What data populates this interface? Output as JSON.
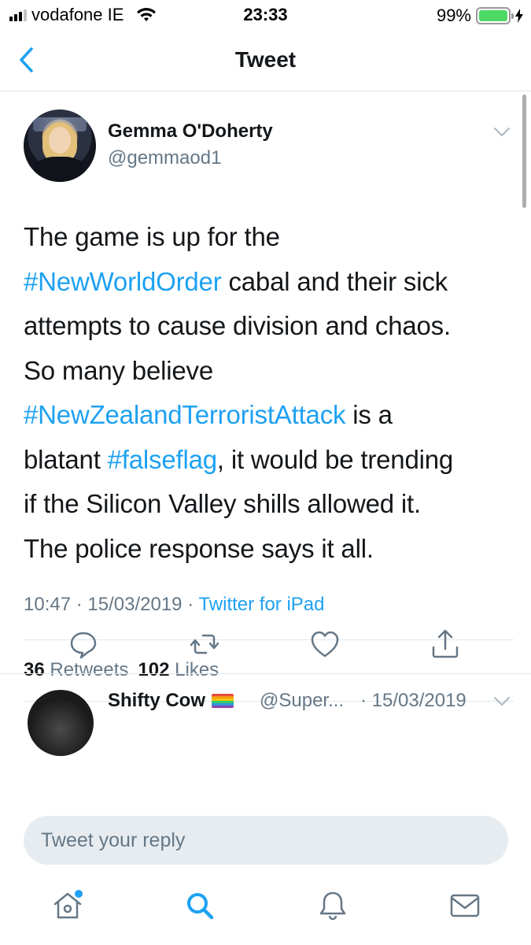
{
  "status_bar": {
    "carrier": "vodafone IE",
    "time": "23:33",
    "battery_percent": "99%",
    "battery_level": 0.99,
    "signal_bars": 4,
    "signal_bars_filled": 3,
    "icons": [
      "signal-icon",
      "wifi-icon",
      "battery-icon",
      "charging-bolt-icon"
    ],
    "battery_color": "#4cd964"
  },
  "nav": {
    "title": "Tweet",
    "back_icon": "chevron-left-icon"
  },
  "tweet": {
    "author_name": "Gemma O'Doherty",
    "author_handle": "@gemmaod1",
    "text_lines": [
      [
        {
          "t": "The game is up for the",
          "link": false
        }
      ],
      [
        {
          "t": "#NewWorldOrder",
          "link": true
        },
        {
          "t": " cabal and their sick",
          "link": false
        }
      ],
      [
        {
          "t": "attempts to cause division and chaos.",
          "link": false
        }
      ],
      [
        {
          "t": "So many believe",
          "link": false
        }
      ],
      [
        {
          "t": "#NewZealandTerroristAttack",
          "link": true
        },
        {
          "t": " is a",
          "link": false
        }
      ],
      [
        {
          "t": "blatant ",
          "link": false
        },
        {
          "t": "#falseflag",
          "link": true
        },
        {
          "t": ", it would be trending",
          "link": false
        }
      ],
      [
        {
          "t": "if the Silicon Valley shills allowed it.",
          "link": false
        }
      ],
      [
        {
          "t": "The police response says it all.",
          "link": false
        }
      ]
    ],
    "time": "10:47",
    "date": "15/03/2019",
    "separator": "·",
    "source": "Twitter for iPad",
    "retweet_count": "36",
    "retweet_label": "Retweets",
    "like_count": "102",
    "like_label": "Likes",
    "actions": [
      "reply-icon",
      "retweet-icon",
      "like-icon",
      "share-icon"
    ]
  },
  "reply_preview": {
    "name": "Shifty Cow",
    "handle": "@Super...",
    "date": "· 15/03/2019"
  },
  "composer": {
    "placeholder": "Tweet your reply"
  },
  "tabs": [
    "home-icon",
    "search-icon",
    "notifications-icon",
    "messages-icon"
  ],
  "colors": {
    "accent": "#1da1f2",
    "text": "#14171a",
    "secondary": "#657786",
    "divider": "#e1e8ed"
  }
}
